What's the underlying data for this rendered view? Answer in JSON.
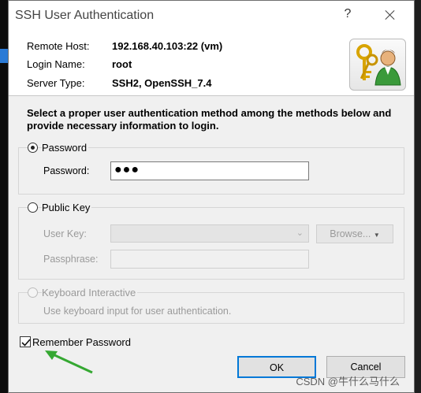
{
  "window": {
    "title": "SSH User Authentication",
    "help_label": "?"
  },
  "info": {
    "remote_host_label": "Remote Host:",
    "remote_host_value": "192.168.40.103:22 (vm)",
    "login_name_label": "Login Name:",
    "login_name_value": "root",
    "server_type_label": "Server Type:",
    "server_type_value": "SSH2, OpenSSH_7.4",
    "icon": "keys-user-icon"
  },
  "instructions": "Select a proper user authentication method among the methods below and provide necessary information to login.",
  "password_group": {
    "radio_label": "Password",
    "selected": true,
    "field_label": "Password:",
    "field_value": "●●●"
  },
  "public_key_group": {
    "radio_label": "Public Key",
    "selected": false,
    "user_key_label": "User Key:",
    "user_key_value": "",
    "browse_label": "Browse...",
    "passphrase_label": "Passphrase:",
    "passphrase_value": ""
  },
  "keyboard_group": {
    "radio_label": "Keyboard Interactive",
    "enabled": false,
    "description": "Use keyboard input for user authentication."
  },
  "remember": {
    "label": "Remember Password",
    "checked": true
  },
  "buttons": {
    "ok_label": "OK",
    "cancel_label": "Cancel"
  },
  "watermark": "CSDN @牛什么马什么",
  "colors": {
    "accent_arrow": "#35a832",
    "dialog_bg": "#f0f0f0"
  }
}
